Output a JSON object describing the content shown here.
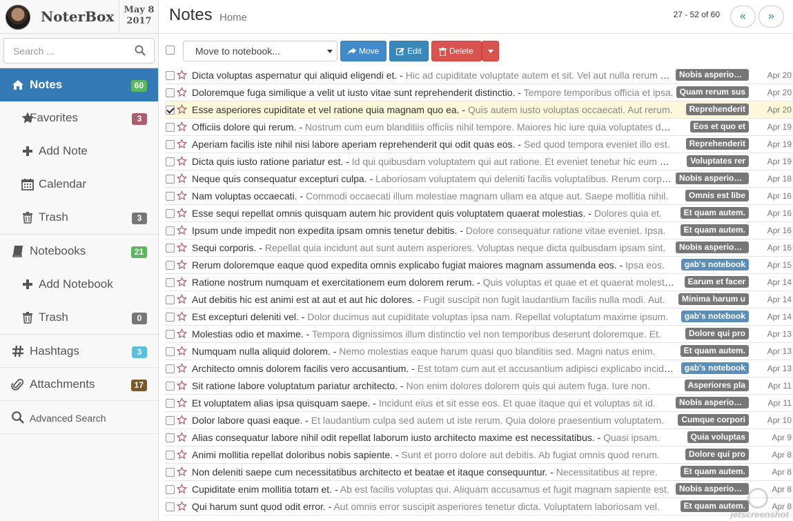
{
  "brand": {
    "name": "NoterBox",
    "date_line1": "May 8",
    "date_line2": "2017"
  },
  "search": {
    "placeholder": "Search ..."
  },
  "sidebar": {
    "items": [
      {
        "label": "Notes",
        "badge": "60",
        "badge_color": "#5cb85c",
        "icon": "home-icon"
      },
      {
        "label": "Favorites",
        "badge": "3",
        "badge_color": "#a8606e",
        "icon": "star-icon"
      },
      {
        "label": "Add Note",
        "icon": "plus-icon"
      },
      {
        "label": "Calendar",
        "icon": "calendar-icon"
      },
      {
        "label": "Trash",
        "badge": "3",
        "badge_color": "#777777",
        "icon": "trash-icon"
      },
      {
        "label": "Notebooks",
        "badge": "21",
        "badge_color": "#5cb85c",
        "icon": "book-icon"
      },
      {
        "label": "Add Notebook",
        "icon": "plus-icon"
      },
      {
        "label": "Trash",
        "badge": "0",
        "badge_color": "#777777",
        "icon": "trash-icon"
      },
      {
        "label": "Hashtags",
        "badge": "3",
        "badge_color": "#5bc0de",
        "icon": "hash-icon"
      },
      {
        "label": "Attachments",
        "badge": "17",
        "badge_color": "#7a5a2a",
        "icon": "paperclip-icon"
      },
      {
        "label": "Advanced Search",
        "icon": "search-icon"
      }
    ]
  },
  "header": {
    "title": "Notes",
    "subtitle": "Home",
    "pager": "27 - 52 of 60",
    "prev": "«",
    "next": "»"
  },
  "toolbar": {
    "move_placeholder": "Move to notebook...",
    "move": "Move",
    "edit": "Edit",
    "delete": "Delete"
  },
  "notes": [
    {
      "title": "Dicta voluptas aspernatur qui aliquid eligendi et.",
      "excerpt": "Hic ad cupiditate voluptate autem et sit. Vel aut nulla rerum mollitia.",
      "notebook": "Nobis asperiores",
      "date": "Apr 20",
      "checked": false
    },
    {
      "title": "Doloremque fuga similique a velit ut iusto vitae sunt reprehenderit distinctio.",
      "excerpt": "Tempore temporibus officia et ipsa.",
      "notebook": "Quam rerum sus",
      "date": "Apr 20",
      "checked": false
    },
    {
      "title": "Esse asperiores cupiditate et vel ratione quia magnam quo ea.",
      "excerpt": "Quis autem iusto voluptas occaecati. Aut rerum.",
      "notebook": "Reprehenderit",
      "date": "Apr 20",
      "checked": true
    },
    {
      "title": "Officiis dolore qui rerum.",
      "excerpt": "Nostrum cum eum blanditiis officiis nihil tempore. Maiores hic iure quia voluptates dolor.",
      "notebook": "Eos et quo et",
      "date": "Apr 19",
      "checked": false
    },
    {
      "title": "Aperiam facilis iste nihil nisi labore aperiam reprehenderit qui odit quas eos.",
      "excerpt": "Sed quod tempora eveniet illo est.",
      "notebook": "Reprehenderit",
      "date": "Apr 19",
      "checked": false
    },
    {
      "title": "Dicta quis iusto ratione pariatur est.",
      "excerpt": "Id qui quibusdam voluptatem qui aut ratione. Et eveniet tenetur hic eum magni.",
      "notebook": "Voluptates rer",
      "date": "Apr 19",
      "checked": false
    },
    {
      "title": "Neque quis consequatur excepturi culpa.",
      "excerpt": "Laboriosam voluptatem qui deleniti facilis voluptatibus. Rerum corporis.",
      "notebook": "Nobis asperiores",
      "date": "Apr 18",
      "checked": false
    },
    {
      "title": "Nam voluptas occaecati.",
      "excerpt": "Commodi occaecati illum molestiae magnam ullam ea atque aut. Saepe mollitia nihil.",
      "notebook": "Omnis est libe",
      "date": "Apr 16",
      "checked": false
    },
    {
      "title": "Esse sequi repellat omnis quisquam autem hic provident quis voluptatem quaerat molestias.",
      "excerpt": "Dolores quia et.",
      "notebook": "Et quam autem.",
      "date": "Apr 16",
      "checked": false
    },
    {
      "title": "Ipsum unde impedit non expedita ipsam omnis tenetur debitis.",
      "excerpt": "Dolore consequatur ratione vitae eveniet. Ipsa.",
      "notebook": "Et quam autem.",
      "date": "Apr 16",
      "checked": false
    },
    {
      "title": "Sequi corporis.",
      "excerpt": "Repellat quia incidunt aut sunt autem asperiores. Voluptas neque dicta quibusdam ipsam sint.",
      "notebook": "Nobis asperiores",
      "date": "Apr 16",
      "checked": false
    },
    {
      "title": "Rerum doloremque eaque quod expedita omnis explicabo fugiat maiores magnam assumenda eos.",
      "excerpt": "Ipsa eos.",
      "notebook": "gab's notebook",
      "date": "Apr 15",
      "checked": false,
      "blue": true
    },
    {
      "title": "Ratione nostrum numquam et exercitationem eum dolorem rerum.",
      "excerpt": "Quis voluptas et quae et et quaerat molestiae.",
      "notebook": "Earum et facer",
      "date": "Apr 14",
      "checked": false
    },
    {
      "title": "Aut debitis hic est animi est at aut et aut hic dolores.",
      "excerpt": "Fugit suscipit non fugit laudantium facilis nulla modi. Aut.",
      "notebook": "Minima harum u",
      "date": "Apr 14",
      "checked": false
    },
    {
      "title": "Est excepturi deleniti vel.",
      "excerpt": "Dolor ducimus aut cupiditate voluptas ipsa nam. Repellat voluptatum maxime ipsum.",
      "notebook": "gab's notebook",
      "date": "Apr 14",
      "checked": false,
      "blue": true
    },
    {
      "title": "Molestias odio et maxime.",
      "excerpt": "Tempora dignissimos illum distinctio vel non temporibus deserunt doloremque. Et.",
      "notebook": "Dolore qui pro",
      "date": "Apr 13",
      "checked": false
    },
    {
      "title": "Numquam nulla aliquid dolorem.",
      "excerpt": "Nemo molestias eaque harum quasi quo blanditiis sed. Magni natus enim.",
      "notebook": "Et quam autem.",
      "date": "Apr 13",
      "checked": false
    },
    {
      "title": "Architecto omnis dolorem facilis vero accusantium.",
      "excerpt": "Est totam cum aut et accusantium adipisci explicabo incidunt.",
      "notebook": "gab's notebook",
      "date": "Apr 13",
      "checked": false,
      "blue": true
    },
    {
      "title": "Sit ratione labore voluptatum pariatur architecto.",
      "excerpt": "Non enim dolores dolorem quis qui autem fuga. Iure non.",
      "notebook": "Asperiores pla",
      "date": "Apr 11",
      "checked": false
    },
    {
      "title": "Et voluptatem alias ipsa quisquam saepe.",
      "excerpt": "Incidunt eius et sit esse eos. Et quae itaque qui et voluptas sit id.",
      "notebook": "Nobis asperiores",
      "date": "Apr 11",
      "checked": false
    },
    {
      "title": "Dolor labore quasi eaque.",
      "excerpt": "Et laudantium culpa sed autem ut iste rerum. Quia dolore praesentium voluptatem.",
      "notebook": "Cumque corpori",
      "date": "Apr 10",
      "checked": false
    },
    {
      "title": "Alias consequatur labore nihil odit repellat laborum iusto architecto maxime est necessitatibus.",
      "excerpt": "Quasi ipsam.",
      "notebook": "Quia voluptas",
      "date": "Apr 9",
      "checked": false
    },
    {
      "title": "Animi mollitia repellat doloribus nobis sapiente.",
      "excerpt": "Sunt et porro dolore aut debitis. Ab fugiat omnis quod rerum.",
      "notebook": "Dolore qui pro",
      "date": "Apr 8",
      "checked": false
    },
    {
      "title": "Non deleniti saepe cum necessitatibus architecto et beatae et itaque consequuntur.",
      "excerpt": "Necessitatibus at repre.",
      "notebook": "Et quam autem.",
      "date": "Apr 8",
      "checked": false
    },
    {
      "title": "Cupiditate enim mollitia totam et.",
      "excerpt": "Ab est facilis voluptas qui. Aliquam accusamus et fugit magnam sapiente est.",
      "notebook": "Nobis asperiores",
      "date": "Apr 8",
      "checked": false
    },
    {
      "title": "Qui harum sunt quod odit error.",
      "excerpt": "Aut omnis error suscipit asperiores tenetur dicta. Voluptatem laboriosam vel.",
      "notebook": "Et quam autem.",
      "date": "Apr 8",
      "checked": false
    }
  ],
  "watermark": "jetscreenshot"
}
